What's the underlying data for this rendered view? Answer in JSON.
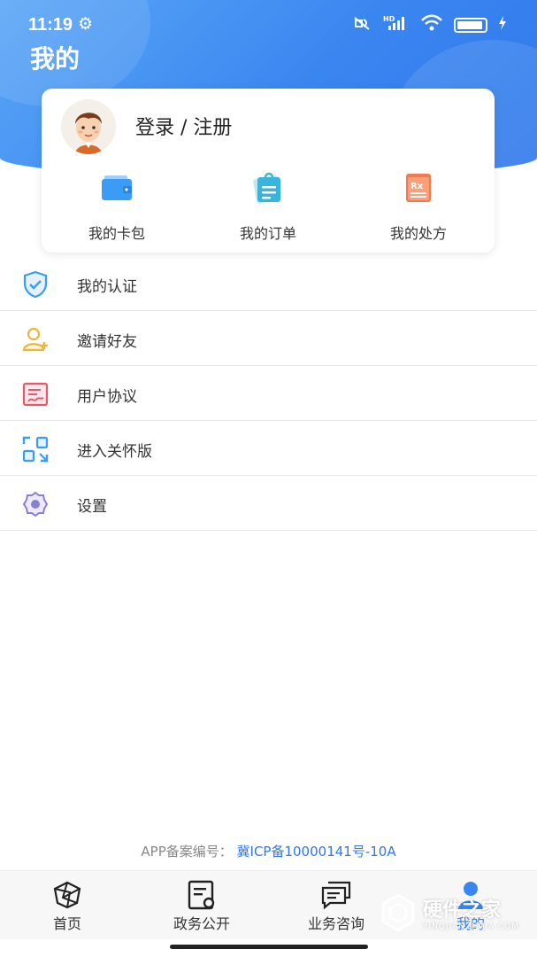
{
  "status_bar": {
    "time": "11:19",
    "gear": "⚙",
    "icons": [
      "mute-icon",
      "hd-signal-icon",
      "wifi-icon",
      "battery-icon",
      "charging-icon"
    ],
    "hd_label": "HD"
  },
  "header": {
    "title": "我的",
    "accent_color": "#3a86f0"
  },
  "profile": {
    "login_label": "登录 / 注册",
    "shortcuts": [
      {
        "label": "我的卡包",
        "icon": "wallet-icon"
      },
      {
        "label": "我的订单",
        "icon": "order-icon"
      },
      {
        "label": "我的处方",
        "icon": "prescription-icon",
        "badge": "Rx"
      }
    ]
  },
  "menu": [
    {
      "label": "我的认证",
      "icon": "shield-check-icon"
    },
    {
      "label": "邀请好友",
      "icon": "add-user-icon"
    },
    {
      "label": "用户协议",
      "icon": "agreement-icon"
    },
    {
      "label": "进入关怀版",
      "icon": "care-mode-icon"
    },
    {
      "label": "设置",
      "icon": "settings-icon"
    }
  ],
  "footer": {
    "icp_prefix": "APP备案编号：",
    "icp_number": "冀ICP备10000141号-10A"
  },
  "tabs": [
    {
      "label": "首页",
      "icon": "home-icon"
    },
    {
      "label": "政务公开",
      "icon": "public-affairs-icon"
    },
    {
      "label": "业务咨询",
      "icon": "consult-icon"
    },
    {
      "label": "我的",
      "icon": "user-icon",
      "active": true
    }
  ],
  "watermark": {
    "text": "硬件之家",
    "sub": "YINGJIANZHIJIA.COM"
  }
}
